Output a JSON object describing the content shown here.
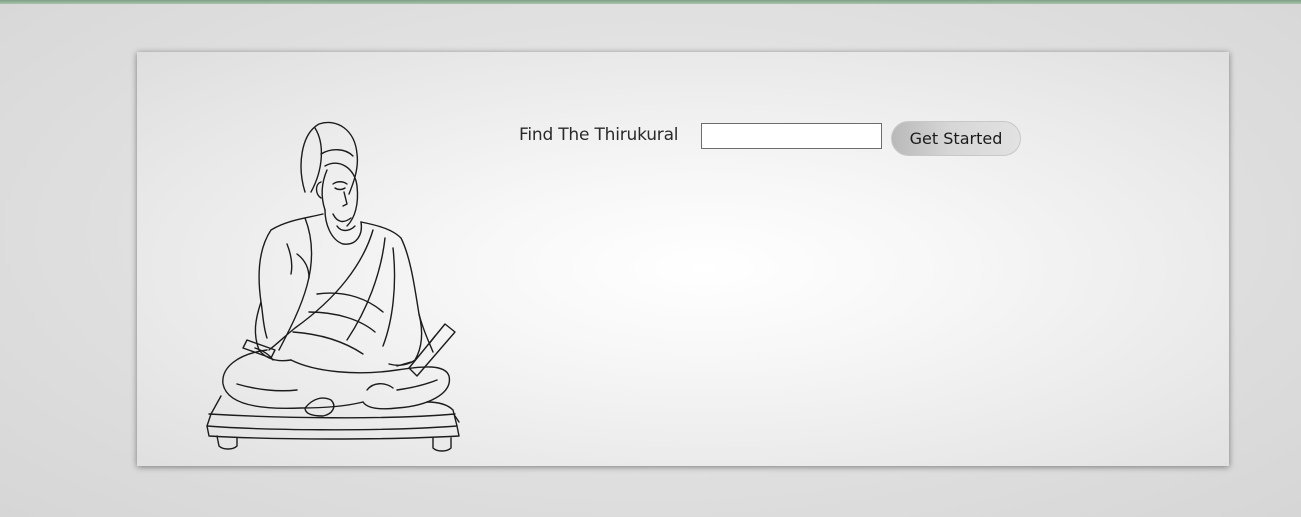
{
  "page": {
    "illustration": {
      "description_icon": "seated-sage-line-drawing"
    },
    "search": {
      "label": "Find The Thirukural",
      "value": "",
      "placeholder": "",
      "button_label": "Get Started"
    },
    "colors": {
      "top_strip": "#8fae94",
      "button_gradient_start": "#b9b9b9",
      "button_gradient_end": "#e2e2e2"
    }
  }
}
